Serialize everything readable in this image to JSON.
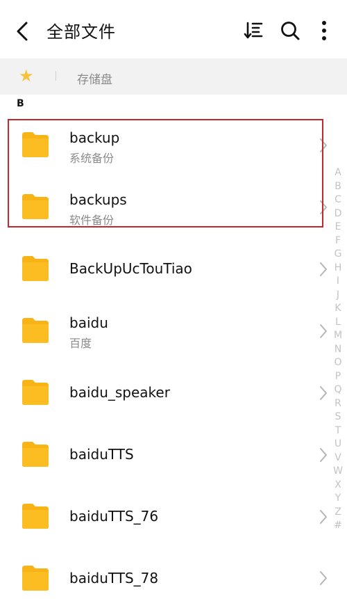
{
  "header": {
    "title": "全部文件",
    "back_icon": "back-arrow-icon",
    "sort_icon": "sort-icon",
    "search_icon": "search-icon",
    "more_icon": "more-vertical-icon"
  },
  "breadcrumb": {
    "favorite_icon": "star-icon",
    "storage_label": "存储盘",
    "accent_color": "#f6c23e"
  },
  "section_letter": "B",
  "files": [
    {
      "name": "backup",
      "subtitle": "系统备份"
    },
    {
      "name": "backups",
      "subtitle": "软件备份"
    },
    {
      "name": "BackUpUcTouTiao",
      "subtitle": ""
    },
    {
      "name": "baidu",
      "subtitle": "百度"
    },
    {
      "name": "baidu_speaker",
      "subtitle": ""
    },
    {
      "name": "baiduTTS",
      "subtitle": ""
    },
    {
      "name": "baiduTTS_76",
      "subtitle": ""
    },
    {
      "name": "baiduTTS_78",
      "subtitle": ""
    }
  ],
  "index_letters": [
    "A",
    "B",
    "C",
    "D",
    "E",
    "F",
    "G",
    "H",
    "I",
    "J",
    "K",
    "L",
    "M",
    "N",
    "O",
    "P",
    "Q",
    "R",
    "S",
    "T",
    "U",
    "V",
    "W",
    "X",
    "Y",
    "Z",
    "#"
  ],
  "colors": {
    "folder": "#f8b316",
    "highlight_border": "#c0282d",
    "subtitle": "#8a8a8a"
  }
}
